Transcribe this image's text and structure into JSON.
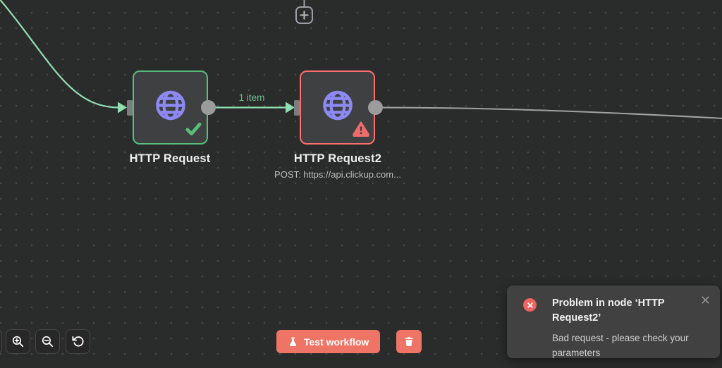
{
  "canvas": {
    "background": "#2a2b2b",
    "dot_color": "#474747"
  },
  "colors": {
    "success_green": "#57bd7a",
    "connection_green": "#90dfb0",
    "error_red": "#ff6e6e",
    "warning_red": "#f06b6b",
    "accent_coral": "#ee7566",
    "icon_purple": "#8d89f2",
    "node_background": "#3f4041",
    "toast_background": "#414141"
  },
  "nodes": [
    {
      "title": "HTTP Request",
      "subtitle": "",
      "status": "success"
    },
    {
      "title": "HTTP Request2",
      "subtitle": "POST: https://api.clickup.com...",
      "status": "error"
    }
  ],
  "connection": {
    "label": "1 item"
  },
  "toolbar": {
    "test_workflow_label": "Test workflow"
  },
  "toast": {
    "title": "Problem in node ‘HTTP Request2’",
    "message": "Bad request - please check your parameters",
    "close_glyph": "×"
  }
}
